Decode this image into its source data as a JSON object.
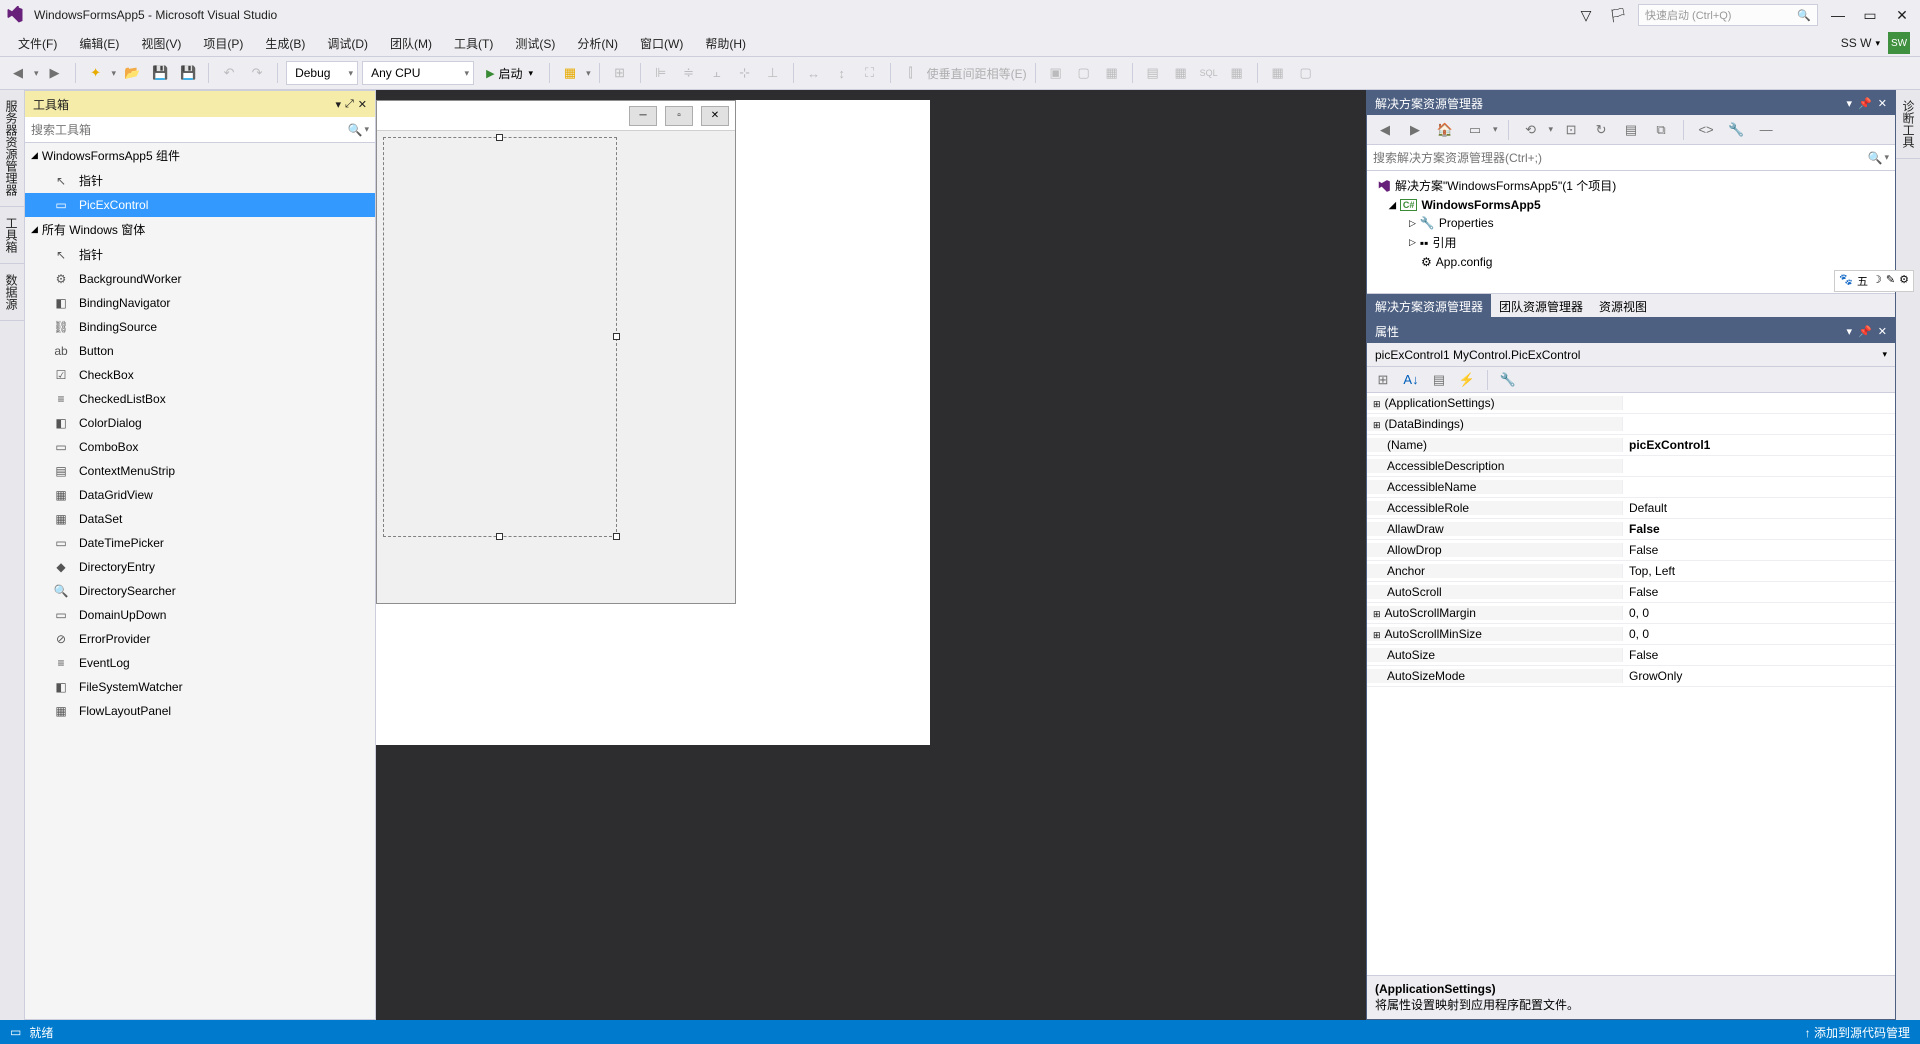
{
  "title": "WindowsFormsApp5 - Microsoft Visual Studio",
  "quick_launch_placeholder": "快速启动 (Ctrl+Q)",
  "user_label": "SS W",
  "user_badge": "SW",
  "menu": [
    "文件(F)",
    "编辑(E)",
    "视图(V)",
    "项目(P)",
    "生成(B)",
    "调试(D)",
    "团队(M)",
    "工具(T)",
    "测试(S)",
    "分析(N)",
    "窗口(W)",
    "帮助(H)"
  ],
  "toolbar": {
    "config": "Debug",
    "platform": "Any CPU",
    "start": "启动",
    "layout_text": "使垂直间距相等(E)"
  },
  "left_tabs": [
    "服务器资源管理器",
    "工具箱",
    "数据源"
  ],
  "right_tab": "诊断工具",
  "toolbox": {
    "title": "工具箱",
    "search_placeholder": "搜索工具箱",
    "groups": [
      {
        "name": "WindowsFormsApp5 组件",
        "items": [
          {
            "icon": "↖",
            "label": "指针"
          },
          {
            "icon": "▭",
            "label": "PicExControl",
            "selected": true
          }
        ]
      },
      {
        "name": "所有 Windows 窗体",
        "items": [
          {
            "icon": "↖",
            "label": "指针"
          },
          {
            "icon": "⚙",
            "label": "BackgroundWorker"
          },
          {
            "icon": "◧",
            "label": "BindingNavigator"
          },
          {
            "icon": "⛓",
            "label": "BindingSource"
          },
          {
            "icon": "ab",
            "label": "Button"
          },
          {
            "icon": "☑",
            "label": "CheckBox"
          },
          {
            "icon": "≡",
            "label": "CheckedListBox"
          },
          {
            "icon": "◧",
            "label": "ColorDialog"
          },
          {
            "icon": "▭",
            "label": "ComboBox"
          },
          {
            "icon": "▤",
            "label": "ContextMenuStrip"
          },
          {
            "icon": "▦",
            "label": "DataGridView"
          },
          {
            "icon": "▦",
            "label": "DataSet"
          },
          {
            "icon": "▭",
            "label": "DateTimePicker"
          },
          {
            "icon": "◆",
            "label": "DirectoryEntry"
          },
          {
            "icon": "🔍",
            "label": "DirectorySearcher"
          },
          {
            "icon": "▭",
            "label": "DomainUpDown"
          },
          {
            "icon": "⊘",
            "label": "ErrorProvider"
          },
          {
            "icon": "≡",
            "label": "EventLog"
          },
          {
            "icon": "◧",
            "label": "FileSystemWatcher"
          },
          {
            "icon": "▦",
            "label": "FlowLayoutPanel"
          }
        ]
      }
    ]
  },
  "solution_explorer": {
    "title": "解决方案资源管理器",
    "search_placeholder": "搜索解决方案资源管理器(Ctrl+;)",
    "solution": "解决方案\"WindowsFormsApp5\"(1 个项目)",
    "project": "WindowsFormsApp5",
    "nodes": [
      "Properties",
      "引用",
      "App.config"
    ],
    "tabs": [
      "解决方案资源管理器",
      "团队资源管理器",
      "资源视图"
    ]
  },
  "properties": {
    "title": "属性",
    "object": "picExControl1 MyControl.PicExControl",
    "rows": [
      {
        "exp": true,
        "name": "(ApplicationSettings)",
        "val": ""
      },
      {
        "exp": true,
        "name": "(DataBindings)",
        "val": ""
      },
      {
        "name": "(Name)",
        "val": "picExControl1",
        "bold": true
      },
      {
        "name": "AccessibleDescription",
        "val": ""
      },
      {
        "name": "AccessibleName",
        "val": ""
      },
      {
        "name": "AccessibleRole",
        "val": "Default"
      },
      {
        "name": "AllawDraw",
        "val": "False",
        "bold": true
      },
      {
        "name": "AllowDrop",
        "val": "False"
      },
      {
        "name": "Anchor",
        "val": "Top, Left"
      },
      {
        "name": "AutoScroll",
        "val": "False"
      },
      {
        "exp": true,
        "name": "AutoScrollMargin",
        "val": "0, 0"
      },
      {
        "exp": true,
        "name": "AutoScrollMinSize",
        "val": "0, 0"
      },
      {
        "name": "AutoSize",
        "val": "False"
      },
      {
        "name": "AutoSizeMode",
        "val": "GrowOnly"
      }
    ],
    "desc_name": "(ApplicationSettings)",
    "desc_text": "将属性设置映射到应用程序配置文件。"
  },
  "statusbar": {
    "ready": "就绪",
    "right": "↑  添加到源代码管理"
  }
}
